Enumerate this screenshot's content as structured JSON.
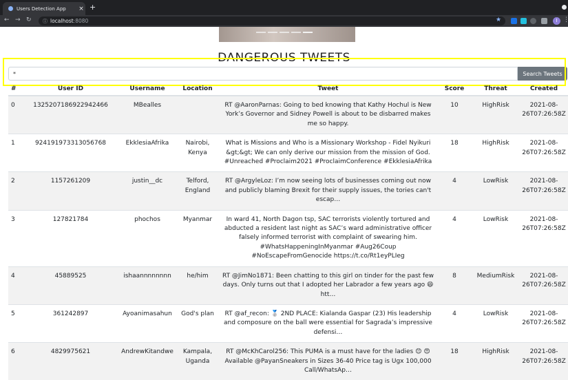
{
  "browser": {
    "tab_title": "Users Detection App",
    "tab_close": "×",
    "new_tab": "+",
    "url_host": "localhost",
    "url_port": ":8080",
    "profile_initial": "I"
  },
  "page": {
    "heading": "DANGEROUS TWEETS",
    "search": {
      "value": "*",
      "button": "Search Tweets"
    }
  },
  "table": {
    "headers": [
      "#",
      "User ID",
      "Username",
      "Location",
      "Tweet",
      "Score",
      "Threat",
      "Created"
    ],
    "rows": [
      {
        "index": "0",
        "user_id": "1325207186922942466",
        "username": "MBealles",
        "location": "",
        "tweet": "RT @AaronParnas: Going to bed knowing that Kathy Hochul is New York’s Governor and Sidney Powell is about to be disbarred makes me so happy.",
        "score": "10",
        "threat": "HighRisk",
        "created": "2021-08-26T07:26:58Z"
      },
      {
        "index": "1",
        "user_id": "924191973313056768",
        "username": "EkklesiaAfrika",
        "location": "Nairobi, Kenya",
        "tweet": "What is Missions and Who is a Missionary Workshop - Fidel Nyikuri &gt;&gt; We can only derive our mission from the mission of God. #Unreached #Proclaim2021 #ProclaimConference #EkklesiaAfrika",
        "score": "18",
        "threat": "HighRisk",
        "created": "2021-08-26T07:26:58Z"
      },
      {
        "index": "2",
        "user_id": "1157261209",
        "username": "justin__dc",
        "location": "Telford, England",
        "tweet": "RT @ArgyleLoz: I’m now seeing lots of businesses coming out now and publicly blaming Brexit for their supply issues, the tories can't escap…",
        "score": "4",
        "threat": "LowRisk",
        "created": "2021-08-26T07:26:58Z"
      },
      {
        "index": "3",
        "user_id": "127821784",
        "username": "phochos",
        "location": "Myanmar",
        "tweet": "In ward 41, North Dagon tsp, SAC terrorists violently tortured and abducted a resident last night as SAC’s ward administrative officer falsely informed terrorist with complaint of swearing him. #WhatsHappeningInMyanmar #Aug26Coup #NoEscapeFromGenocide https://t.co/Rt1eyPLIeg",
        "score": "4",
        "threat": "LowRisk",
        "created": "2021-08-26T07:26:58Z"
      },
      {
        "index": "4",
        "user_id": "45889525",
        "username": "ishaannnnnnnn",
        "location": "he/him",
        "tweet": "RT @JimNo1871: Been chatting to this girl on tinder for the past few days. Only turns out that I adopted her Labrador a few years ago 😄 htt…",
        "score": "8",
        "threat": "MediumRisk",
        "created": "2021-08-26T07:26:58Z"
      },
      {
        "index": "5",
        "user_id": "361242897",
        "username": "Ayoanimasahun",
        "location": "God's plan",
        "tweet": "RT @af_recon: 🥈 2ND PLACE: Kialanda Gaspar (23) His leadership and composure on the ball were essential for Sagrada’s impressive defensi…",
        "score": "4",
        "threat": "LowRisk",
        "created": "2021-08-26T07:26:58Z"
      },
      {
        "index": "6",
        "user_id": "4829975621",
        "username": "AndrewKitandwe",
        "location": "Kampala, Uganda",
        "tweet": "RT @McKhCarol256: This PUMA is a must have for the ladies 😊 😍 Available @PayanSneakers in Sizes 36-40 Price tag is Ugx 100,000 Call/WhatsAp…",
        "score": "18",
        "threat": "HighRisk",
        "created": "2021-08-26T07:26:58Z"
      }
    ]
  }
}
